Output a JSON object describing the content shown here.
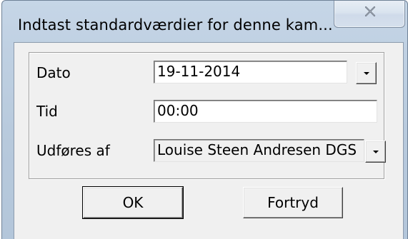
{
  "window": {
    "title": "Indtast standardværdier for denne kam..."
  },
  "fields": {
    "date": {
      "label": "Dato",
      "value": "19-11-2014"
    },
    "time": {
      "label": "Tid",
      "value": "00:00"
    },
    "performed_by": {
      "label": "Udføres af",
      "value": "Louise Steen Andresen DGS"
    }
  },
  "buttons": {
    "ok_label": "OK",
    "cancel_label": "Fortryd"
  },
  "icons": {
    "close": "close-icon",
    "dropdown": "chevron-down-icon"
  }
}
